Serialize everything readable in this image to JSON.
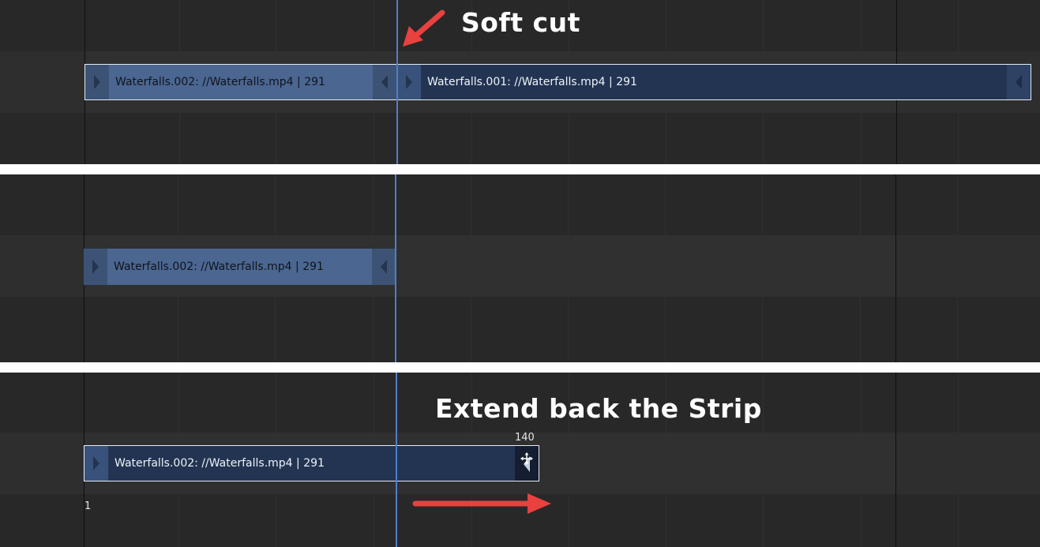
{
  "annotations": {
    "soft_cut": "Soft cut",
    "extend_back": "Extend back the Strip"
  },
  "panel1": {
    "strip_left": {
      "name": "Waterfalls.002: //Waterfalls.mp4 | 291"
    },
    "strip_right": {
      "name": "Waterfalls.001: //Waterfalls.mp4 | 291"
    }
  },
  "panel2": {
    "strip": {
      "name": "Waterfalls.002: //Waterfalls.mp4 | 291"
    }
  },
  "panel3": {
    "strip": {
      "name": "Waterfalls.002: //Waterfalls.mp4 | 291"
    },
    "frame_start": "1",
    "frame_end": "140"
  },
  "colors": {
    "arrow": "#e8413f",
    "playhead": "#4f7fc7",
    "strip_selected": "#233452",
    "strip_unselected": "#4b6690"
  }
}
